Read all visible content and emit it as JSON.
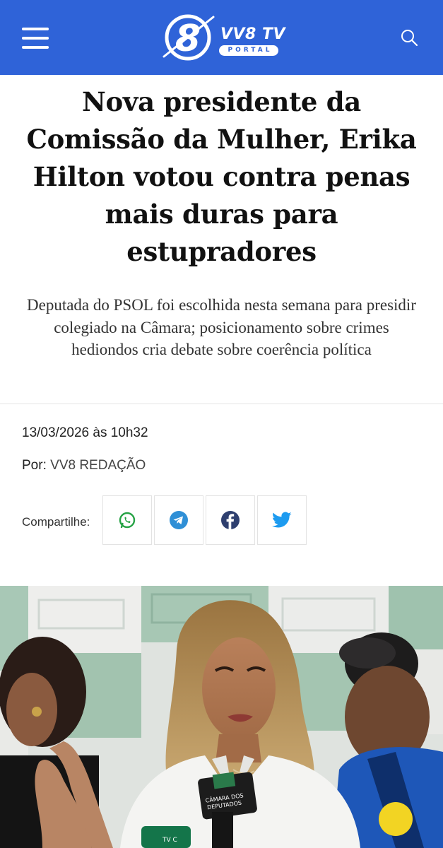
{
  "header": {
    "logo_text": "VV8 TV",
    "logo_sub": "PORTAL",
    "brand_color": "#2f63d8",
    "menu_icon": "hamburger-menu-icon",
    "search_icon": "search-icon"
  },
  "article": {
    "headline": "Nova presidente da Comissão da Mulher, Erika Hilton votou contra penas mais duras para estupradores",
    "subtitle": "Deputada do PSOL foi escolhida nesta semana para presidir colegiado na Câmara; posicionamento sobre crimes hediondos cria debate sobre coerência política",
    "date": "13/03/2026 às 10h32",
    "byline_label": "Por:",
    "author": "VV8 REDAÇÃO"
  },
  "share": {
    "label": "Compartilhe:",
    "buttons": [
      {
        "name": "whatsapp",
        "icon": "whatsapp-icon",
        "color": "#25a244"
      },
      {
        "name": "telegram",
        "icon": "telegram-icon",
        "color": "#2f8fd6"
      },
      {
        "name": "facebook",
        "icon": "facebook-icon",
        "color": "#2e3f6f"
      },
      {
        "name": "twitter",
        "icon": "twitter-icon",
        "color": "#1d9bf0"
      }
    ]
  },
  "photo": {
    "mic_label_1": "CÂMARA DOS",
    "mic_label_2": "DEPUTADOS",
    "mic_label_3": "TV C"
  }
}
